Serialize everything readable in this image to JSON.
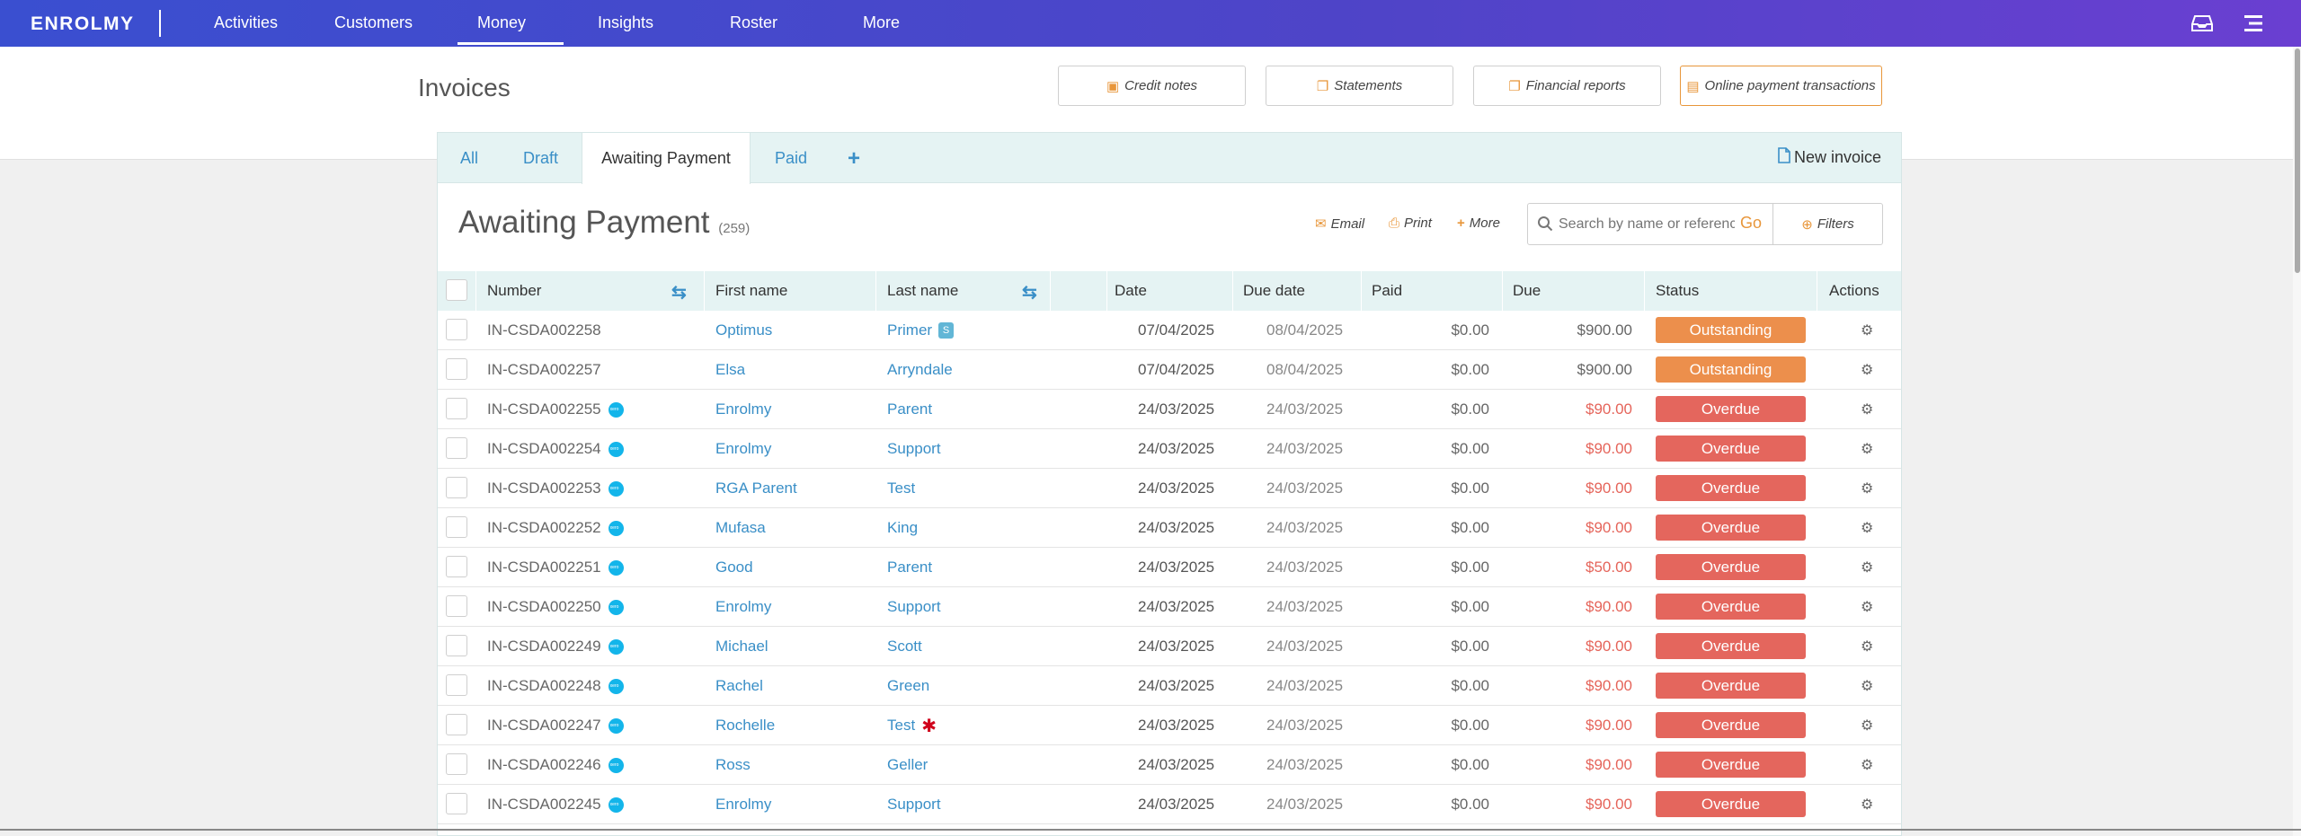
{
  "brand": "ENROLMY",
  "nav": {
    "items": [
      "Activities",
      "Customers",
      "Money",
      "Insights",
      "Roster",
      "More"
    ],
    "active": "Money"
  },
  "page": {
    "title": "Invoices",
    "buttons": {
      "credit_notes": "Credit notes",
      "statements": "Statements",
      "financial_reports": "Financial reports",
      "online_payments": "Online payment transactions"
    }
  },
  "tabs": {
    "all": "All",
    "draft": "Draft",
    "awaiting": "Awaiting Payment",
    "paid": "Paid",
    "plus": "+",
    "new_invoice": "New invoice"
  },
  "section": {
    "title": "Awaiting Payment",
    "count": "(259)",
    "email": "Email",
    "print": "Print",
    "more": "More"
  },
  "search": {
    "placeholder": "Search by name or reference",
    "go": "Go",
    "filters": "Filters"
  },
  "columns": {
    "number": "Number",
    "first_name": "First name",
    "last_name": "Last name",
    "date": "Date",
    "due_date": "Due date",
    "paid": "Paid",
    "due": "Due",
    "status": "Status",
    "actions": "Actions"
  },
  "rows": [
    {
      "number": "IN-CSDA002258",
      "xero": false,
      "first": "Optimus",
      "last": "Primer",
      "badge": "S",
      "star": false,
      "date": "07/04/2025",
      "due_date": "08/04/2025",
      "paid": "$0.00",
      "due": "$900.00",
      "status": "Outstanding"
    },
    {
      "number": "IN-CSDA002257",
      "xero": false,
      "first": "Elsa",
      "last": "Arryndale",
      "badge": "",
      "star": false,
      "date": "07/04/2025",
      "due_date": "08/04/2025",
      "paid": "$0.00",
      "due": "$900.00",
      "status": "Outstanding"
    },
    {
      "number": "IN-CSDA002255",
      "xero": true,
      "first": "Enrolmy",
      "last": "Parent",
      "badge": "",
      "star": false,
      "date": "24/03/2025",
      "due_date": "24/03/2025",
      "paid": "$0.00",
      "due": "$90.00",
      "status": "Overdue"
    },
    {
      "number": "IN-CSDA002254",
      "xero": true,
      "first": "Enrolmy",
      "last": "Support",
      "badge": "",
      "star": false,
      "date": "24/03/2025",
      "due_date": "24/03/2025",
      "paid": "$0.00",
      "due": "$90.00",
      "status": "Overdue"
    },
    {
      "number": "IN-CSDA002253",
      "xero": true,
      "first": "RGA Parent",
      "last": "Test",
      "badge": "",
      "star": false,
      "date": "24/03/2025",
      "due_date": "24/03/2025",
      "paid": "$0.00",
      "due": "$90.00",
      "status": "Overdue"
    },
    {
      "number": "IN-CSDA002252",
      "xero": true,
      "first": "Mufasa",
      "last": "King",
      "badge": "",
      "star": false,
      "date": "24/03/2025",
      "due_date": "24/03/2025",
      "paid": "$0.00",
      "due": "$90.00",
      "status": "Overdue"
    },
    {
      "number": "IN-CSDA002251",
      "xero": true,
      "first": "Good",
      "last": "Parent",
      "badge": "",
      "star": false,
      "date": "24/03/2025",
      "due_date": "24/03/2025",
      "paid": "$0.00",
      "due": "$50.00",
      "status": "Overdue"
    },
    {
      "number": "IN-CSDA002250",
      "xero": true,
      "first": "Enrolmy",
      "last": "Support",
      "badge": "",
      "star": false,
      "date": "24/03/2025",
      "due_date": "24/03/2025",
      "paid": "$0.00",
      "due": "$90.00",
      "status": "Overdue"
    },
    {
      "number": "IN-CSDA002249",
      "xero": true,
      "first": "Michael",
      "last": "Scott",
      "badge": "",
      "star": false,
      "date": "24/03/2025",
      "due_date": "24/03/2025",
      "paid": "$0.00",
      "due": "$90.00",
      "status": "Overdue"
    },
    {
      "number": "IN-CSDA002248",
      "xero": true,
      "first": "Rachel",
      "last": "Green",
      "badge": "",
      "star": false,
      "date": "24/03/2025",
      "due_date": "24/03/2025",
      "paid": "$0.00",
      "due": "$90.00",
      "status": "Overdue"
    },
    {
      "number": "IN-CSDA002247",
      "xero": true,
      "first": "Rochelle",
      "last": "Test",
      "badge": "",
      "star": true,
      "date": "24/03/2025",
      "due_date": "24/03/2025",
      "paid": "$0.00",
      "due": "$90.00",
      "status": "Overdue"
    },
    {
      "number": "IN-CSDA002246",
      "xero": true,
      "first": "Ross",
      "last": "Geller",
      "badge": "",
      "star": false,
      "date": "24/03/2025",
      "due_date": "24/03/2025",
      "paid": "$0.00",
      "due": "$90.00",
      "status": "Overdue"
    },
    {
      "number": "IN-CSDA002245",
      "xero": true,
      "first": "Enrolmy",
      "last": "Support",
      "badge": "",
      "star": false,
      "date": "24/03/2025",
      "due_date": "24/03/2025",
      "paid": "$0.00",
      "due": "$90.00",
      "status": "Overdue"
    }
  ],
  "colors": {
    "nav_gradient_start": "#3a4fd0",
    "nav_gradient_end": "#6a3fd1",
    "link": "#3a8fc7",
    "accent": "#e8963a",
    "outstanding": "#ec8f4c",
    "overdue": "#e4665d"
  }
}
